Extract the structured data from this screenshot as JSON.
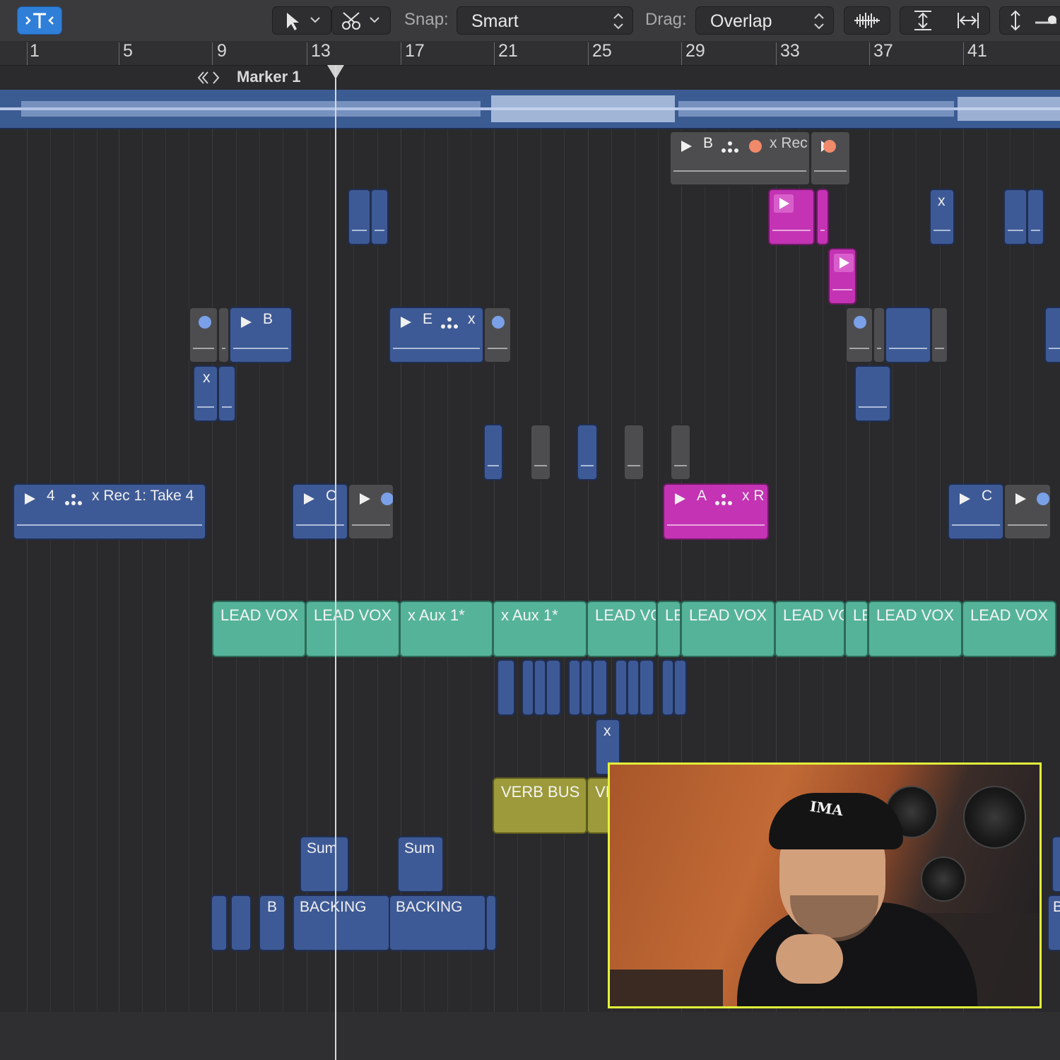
{
  "toolbar": {
    "snap_label": "Snap:",
    "snap_value": "Smart",
    "drag_label": "Drag:",
    "drag_value": "Overlap",
    "icons": [
      "catch-icon",
      "pointer-tool-icon",
      "scissors-tool-icon",
      "waveform-zoom-icon",
      "vertical-zoom-icon",
      "horizontal-zoom-icon",
      "track-height-icon"
    ]
  },
  "ruler": {
    "bars": [
      "1",
      "5",
      "9",
      "13",
      "17",
      "21",
      "25",
      "29",
      "33",
      "37",
      "41"
    ],
    "marker_label": "Marker 1"
  },
  "regions": {
    "r1": "B",
    "r1b": "x Rec",
    "r2": "x",
    "r3": "B",
    "r4": "E",
    "r4b": "x",
    "r5": "x",
    "r6": "4",
    "r6b": "x Rec 1: Take 4",
    "r7": "C",
    "r8": "A",
    "r8b": "x R",
    "r9": "C",
    "r10": "x",
    "teal": [
      "LEAD VOX",
      "LEAD VOX",
      "x Aux 1*",
      "x Aux 1*",
      "LEAD VC",
      "LE",
      "LEAD VOX",
      "LEAD VC",
      "LE",
      "LEAD VOX",
      "LEAD VOX"
    ],
    "verb1": "VERB BUS",
    "verb2": "VI",
    "sum1": "Sum",
    "sum2": "Sum",
    "b_small": "B",
    "backing1": "BACKING",
    "backing2": "BACKING",
    "b_edge": "B"
  },
  "video": {
    "cap_logo": "IMA"
  },
  "colors": {
    "accent": "#2f7fd8",
    "blue_region": "#3e5a96",
    "pink_region": "#c433b4",
    "teal_region": "#55b39a",
    "olive_region": "#9c9a3a",
    "video_border": "#e2f53b"
  }
}
